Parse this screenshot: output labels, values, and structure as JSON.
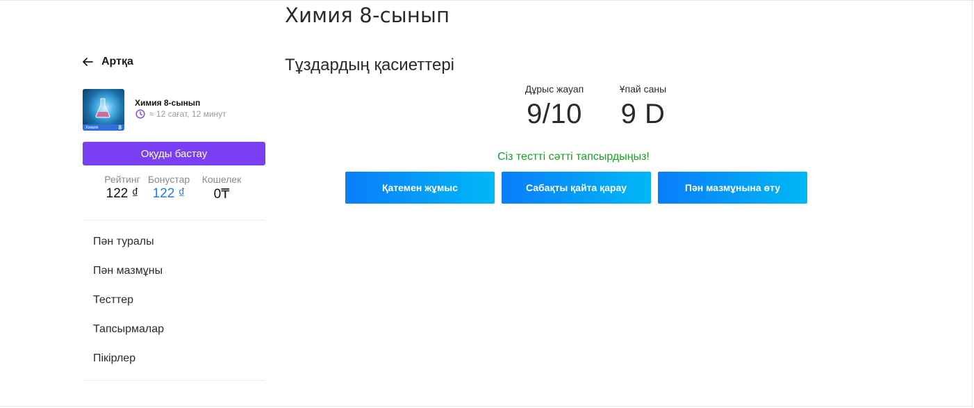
{
  "header": {
    "title": "Химия 8-сынып"
  },
  "sidebar": {
    "back_label": "Артқа",
    "course": {
      "thumb_caption": "Химия",
      "thumb_grade": "8",
      "name": "Химия 8-сынып",
      "duration": "≈ 12 сағат, 12 минут"
    },
    "start_label": "Оқуды бастау",
    "stats": {
      "rating_label": "Рейтинг",
      "rating_value": "122 ₫",
      "bonus_label": "Бонустар",
      "bonus_value": "122 ₫",
      "wallet_label": "Кошелек",
      "wallet_value": "0₸"
    },
    "items": [
      {
        "label": "Пән туралы"
      },
      {
        "label": "Пән мазмұны"
      },
      {
        "label": "Тесттер"
      },
      {
        "label": "Тапсырмалар"
      },
      {
        "label": "Пікірлер"
      }
    ]
  },
  "main": {
    "lesson_title": "Тұздардың қасиеттері",
    "correct_label": "Дұрыс жауап",
    "correct_value": "9/10",
    "points_label": "Ұпай саны",
    "points_value": "9 D",
    "success_message": "Сіз тестті сәтті тапсырдыңыз!",
    "buttons": {
      "mistakes": "Қатемен жұмыс",
      "review": "Сабақты қайта қарау",
      "content": "Пән мазмұнына өту"
    }
  },
  "colors": {
    "accent_purple": "#7a3ff2",
    "bonus_blue": "#1e7bf2",
    "success_green": "#17a21b",
    "button_gradient_start": "#0a7dfb",
    "button_gradient_end": "#00b8f5"
  }
}
